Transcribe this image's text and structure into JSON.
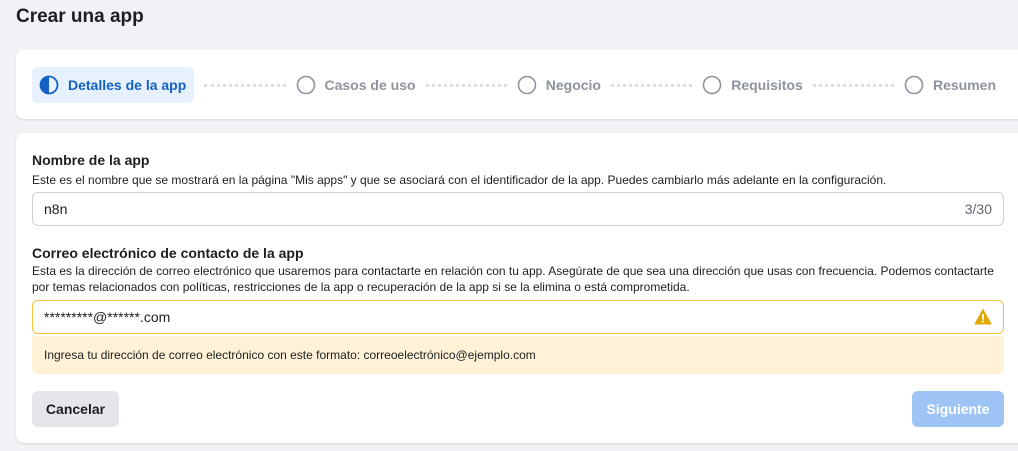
{
  "page": {
    "title": "Crear una app"
  },
  "stepper": {
    "steps": [
      {
        "label": "Detalles de la app",
        "state": "active"
      },
      {
        "label": "Casos de uso",
        "state": "pending"
      },
      {
        "label": "Negocio",
        "state": "pending"
      },
      {
        "label": "Requisitos",
        "state": "pending"
      },
      {
        "label": "Resumen",
        "state": "pending"
      }
    ]
  },
  "form": {
    "app_name": {
      "label": "Nombre de la app",
      "description": "Este es el nombre que se mostrará en la página \"Mis apps\" y que se asociará con el identificador de la app. Puedes cambiarlo más adelante en la configuración.",
      "value": "n8n",
      "char_count": "3/30"
    },
    "contact_email": {
      "label": "Correo electrónico de contacto de la app",
      "description": "Esta es la dirección de correo electrónico que usaremos para contactarte en relación con tu app. Asegúrate de que sea una dirección que usas con frecuencia. Podemos contactarte por temas relacionados con políticas, restricciones de la app o recuperación de la app si se la elimina o está comprometida.",
      "value": "*********@******.com",
      "warning_icon": "warning-triangle-icon",
      "warning": "Ingresa tu dirección de correo electrónico con este formato: correoelectrónico@ejemplo.com"
    }
  },
  "actions": {
    "cancel_label": "Cancelar",
    "next_label": "Siguiente"
  },
  "colors": {
    "accent": "#1261c4",
    "active_step_bg": "#e7f0fd",
    "warning_border": "#f5c33b",
    "warning_bg": "#fff2d6",
    "disabled_primary": "#9ec3f5"
  }
}
